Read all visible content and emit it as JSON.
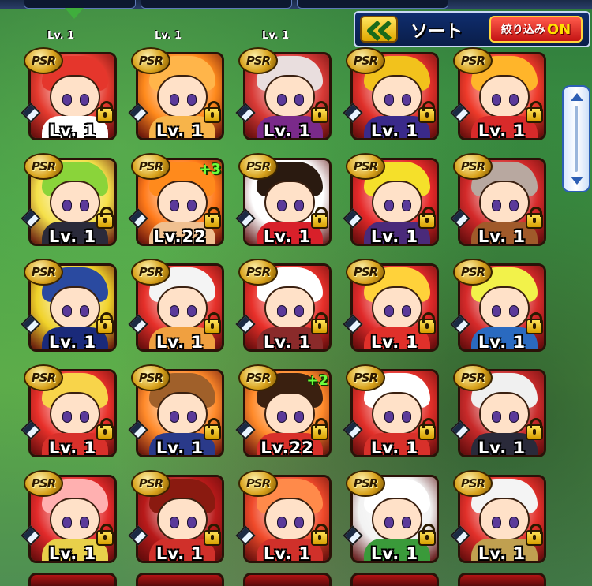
{
  "header": {
    "sort_label": "ソート",
    "filter_label": "絞り込み",
    "filter_state": "ON",
    "back_icon": "double-chevron-left-icon",
    "partial_level_label": "Lv. 1"
  },
  "cards": [
    {
      "rarity": "PSR",
      "level": "Lv. 1",
      "plus": "",
      "bg": "#e43a2e",
      "hair": "#e5362c",
      "shirt": "#ffffff"
    },
    {
      "rarity": "PSR",
      "level": "Lv. 1",
      "plus": "",
      "bg": "#ff8a1c",
      "hair": "#ffb54a",
      "shirt": "#f7b44a"
    },
    {
      "rarity": "PSR",
      "level": "Lv. 1",
      "plus": "",
      "bg": "#d83a36",
      "hair": "#e9dede",
      "shirt": "#7a2a8a"
    },
    {
      "rarity": "PSR",
      "level": "Lv. 1",
      "plus": "",
      "bg": "#e0302a",
      "hair": "#f2c21c",
      "shirt": "#3a2a8a"
    },
    {
      "rarity": "PSR",
      "level": "Lv. 1",
      "plus": "",
      "bg": "#ee3a2a",
      "hair": "#ffb52a",
      "shirt": "#d82a2a"
    },
    {
      "rarity": "PSR",
      "level": "Lv. 1",
      "plus": "",
      "bg": "#f5e04a",
      "hair": "#8ad43a",
      "shirt": "#2a2a3a"
    },
    {
      "rarity": "PSR",
      "level": "Lv.22",
      "plus": "+3",
      "bg": "#ff7a1a",
      "hair": "#ff8a1c",
      "shirt": "#f0c090"
    },
    {
      "rarity": "PSR",
      "level": "Lv. 1",
      "plus": "",
      "bg": "#ffffff",
      "hair": "#2a1a10",
      "shirt": "#d8202a"
    },
    {
      "rarity": "PSR",
      "level": "Lv. 1",
      "plus": "",
      "bg": "#e62a2a",
      "hair": "#f5e02a",
      "shirt": "#4a2a7a"
    },
    {
      "rarity": "PSR",
      "level": "Lv. 1",
      "plus": "",
      "bg": "#d42a2a",
      "hair": "#b8a8a0",
      "shirt": "#a05a2a"
    },
    {
      "rarity": "PSR",
      "level": "Lv. 1",
      "plus": "",
      "bg": "#f0d22a",
      "hair": "#2a4aa0",
      "shirt": "#1a2a7a"
    },
    {
      "rarity": "PSR",
      "level": "Lv. 1",
      "plus": "",
      "bg": "#e6302a",
      "hair": "#f4f4f4",
      "shirt": "#f0a040"
    },
    {
      "rarity": "PSR",
      "level": "Lv. 1",
      "plus": "",
      "bg": "#e8302a",
      "hair": "#ffffff",
      "shirt": "#8a2a2a"
    },
    {
      "rarity": "PSR",
      "level": "Lv. 1",
      "plus": "",
      "bg": "#e02a2a",
      "hair": "#ffd23a",
      "shirt": "#e0302a"
    },
    {
      "rarity": "PSR",
      "level": "Lv. 1",
      "plus": "",
      "bg": "#d62a2a",
      "hair": "#f2f24a",
      "shirt": "#2a6ac0"
    },
    {
      "rarity": "PSR",
      "level": "Lv. 1",
      "plus": "",
      "bg": "#e8302a",
      "hair": "#f8d44a",
      "shirt": "#d8302a"
    },
    {
      "rarity": "PSR",
      "level": "Lv. 1",
      "plus": "",
      "bg": "#ff8a2a",
      "hair": "#a0602a",
      "shirt": "#2a3a8a"
    },
    {
      "rarity": "PSR",
      "level": "Lv.22",
      "plus": "+2",
      "bg": "#ff8a2a",
      "hair": "#3a2010",
      "shirt": "#d8302a"
    },
    {
      "rarity": "PSR",
      "level": "Lv. 1",
      "plus": "",
      "bg": "#e2302a",
      "hair": "#ffffff",
      "shirt": "#d8302a"
    },
    {
      "rarity": "PSR",
      "level": "Lv. 1",
      "plus": "",
      "bg": "#c82a2a",
      "hair": "#f0f0f0",
      "shirt": "#2a2a3a"
    },
    {
      "rarity": "PSR",
      "level": "Lv. 1",
      "plus": "",
      "bg": "#e22a2a",
      "hair": "#ffb0b0",
      "shirt": "#e8d04a"
    },
    {
      "rarity": "PSR",
      "level": "Lv. 1",
      "plus": "",
      "bg": "#b81a1a",
      "hair": "#8a1a10",
      "shirt": "#d0302a"
    },
    {
      "rarity": "PSR",
      "level": "Lv. 1",
      "plus": "",
      "bg": "#f04a2a",
      "hair": "#ff8a4a",
      "shirt": "#d0302a"
    },
    {
      "rarity": "PSR",
      "level": "Lv. 1",
      "plus": "",
      "bg": "#f2f2f2",
      "hair": "#ffffff",
      "shirt": "#3a9a3a"
    },
    {
      "rarity": "PSR",
      "level": "Lv. 1",
      "plus": "",
      "bg": "#e2302a",
      "hair": "#f4f4f4",
      "shirt": "#c0a050"
    }
  ]
}
